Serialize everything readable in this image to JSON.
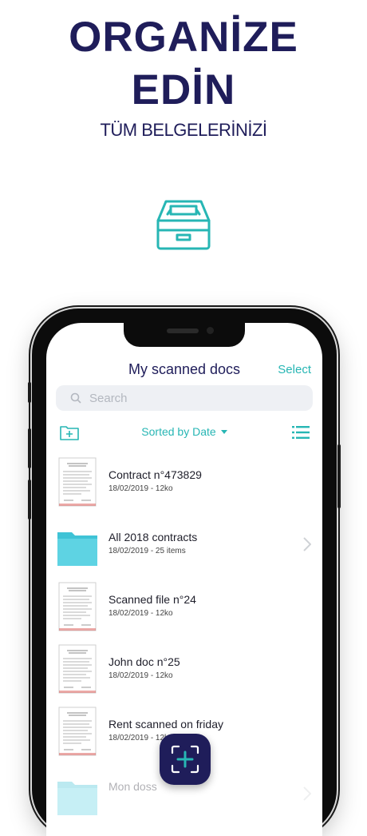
{
  "headline": {
    "line1": "ORGANİZE",
    "line2": "EDİN",
    "subline": "TÜM BELGELERİNİZİ"
  },
  "colors": {
    "navy": "#1f1d5a",
    "accent": "#27b6b4"
  },
  "app": {
    "title": "My scanned docs",
    "select_label": "Select",
    "search_placeholder": "Search",
    "sort_label": "Sorted by Date",
    "icons": [
      "inbox-tray-icon",
      "search-icon",
      "add-folder-icon",
      "list-view-icon",
      "chevron-right-icon",
      "scan-add-icon"
    ]
  },
  "items": [
    {
      "type": "doc",
      "title": "Contract n°473829",
      "meta": "18/02/2019 - 12ko"
    },
    {
      "type": "folder",
      "title": "All 2018 contracts",
      "meta": "18/02/2019 - 25 items"
    },
    {
      "type": "doc",
      "title": "Scanned file n°24",
      "meta": "18/02/2019 - 12ko"
    },
    {
      "type": "doc",
      "title": "John doc n°25",
      "meta": "18/02/2019 - 12ko"
    },
    {
      "type": "doc",
      "title": "Rent scanned on friday",
      "meta": "18/02/2019 - 12ko"
    },
    {
      "type": "folder",
      "title": "Mon doss",
      "meta": ""
    }
  ]
}
